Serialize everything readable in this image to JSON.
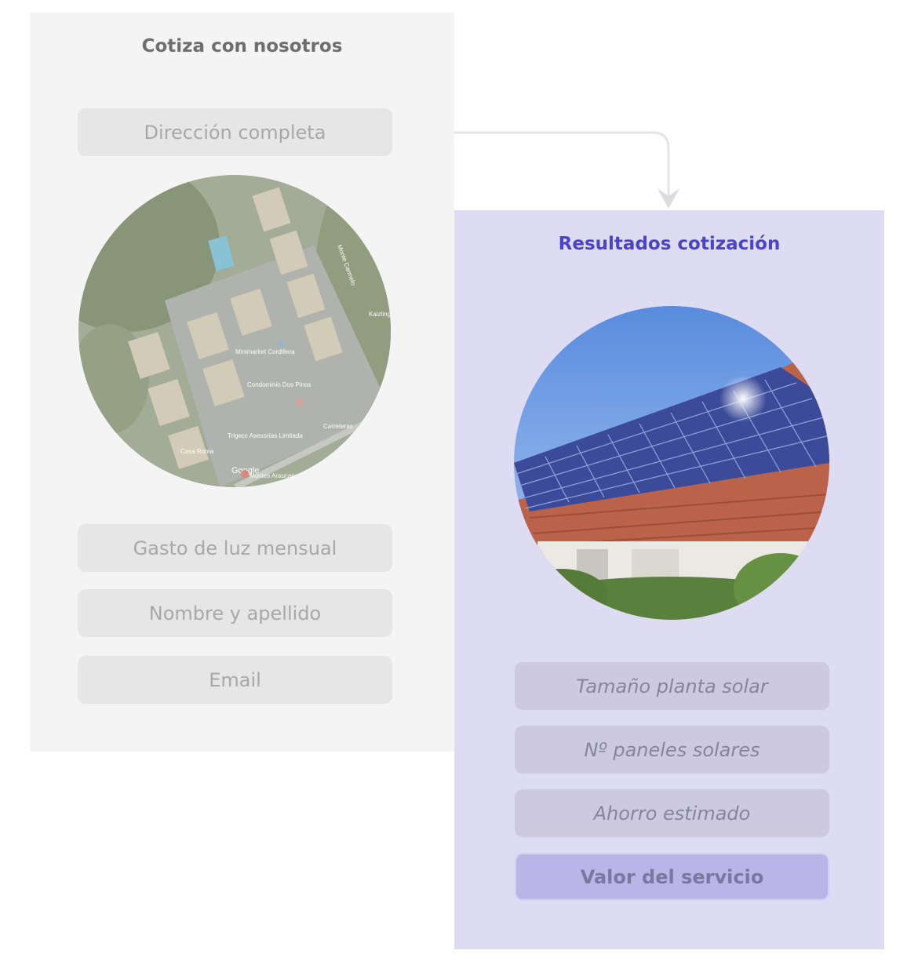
{
  "quote_form": {
    "title": "Cotiza con nosotros",
    "fields": {
      "address": "Dirección completa",
      "monthly_bill": "Gasto de luz mensual",
      "full_name": "Nombre y apellido",
      "email": "Email"
    },
    "map_labels": {
      "watermark": "Google",
      "place_1": "Minimarket Cordillera",
      "place_2": "Condominio Dos Pinos",
      "place_3": "Trigecc Asesorías Limitada",
      "place_4": "Carreteras",
      "place_5": "Casa Roma",
      "street_1": "Monte Carmelo",
      "street_2": "Montes Araucanos",
      "street_3": "Kaizling"
    }
  },
  "results": {
    "title": "Resultados cotización",
    "fields": {
      "plant_size": "Tamaño planta solar",
      "panel_count": "Nº paneles solares",
      "estimated_savings": "Ahorro estimado",
      "service_value": "Valor del servicio"
    }
  },
  "colors": {
    "results_title": "#4a44c6",
    "results_panel_bg": "#dedcf2",
    "form_panel_bg": "#f4f4f4"
  }
}
